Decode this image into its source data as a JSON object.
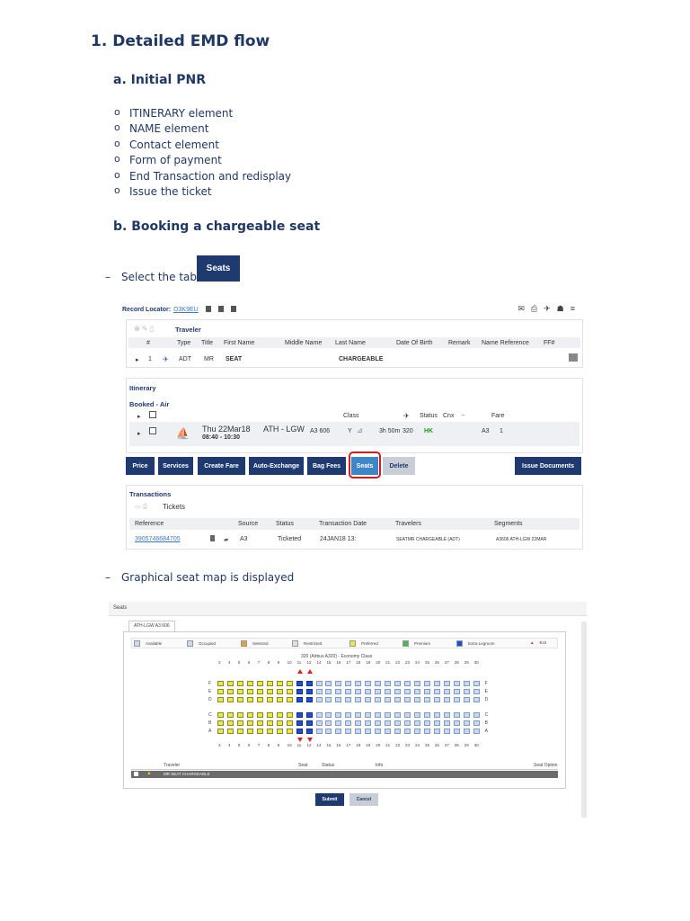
{
  "doc": {
    "h1": "1. Detailed EMD flow",
    "h2a": "a. Initial PNR",
    "bullets": [
      "ITINERARY element",
      "NAME element",
      "Contact element",
      "Form of payment",
      "End Transaction and redisplay",
      "Issue the ticket"
    ],
    "h2b": "b. Booking a chargeable seat",
    "step1": "Select the tab",
    "step1_badge": "Seats",
    "step2": "Graphical seat map is displayed",
    "dash": "–"
  },
  "pnr": {
    "record_locator_label": "Record Locator:",
    "record_locator": "O3K9EU",
    "traveler_title": "Traveler",
    "trav_cols": [
      "#",
      "Type",
      "Title",
      "First Name",
      "Middle Name",
      "Last Name",
      "Date Of Birth",
      "Remark",
      "Name Reference",
      "FF#"
    ],
    "trav_row": {
      "num": "1",
      "type": "ADT",
      "title": "MR",
      "first": "SEAT",
      "last": "CHARGEABLE"
    },
    "itinerary_title": "Itinerary",
    "booked_air": "Booked - Air",
    "itin_cols": {
      "class": "Class",
      "status": "Status",
      "cnx": "Cnx",
      "fare": "Fare"
    },
    "flight": {
      "date": "Thu 22Mar18",
      "time": "08:40 - 10:30",
      "route": "ATH - LGW",
      "flight": "A3 606",
      "class": "Y",
      "duration": "3h 50m",
      "equipment": "320",
      "status": "HK",
      "fare_carrier": "A3",
      "fare_num": "1"
    },
    "buttons": [
      "Price",
      "Services",
      "Create Fare",
      "Auto-Exchange",
      "Bag Fees",
      "Seats",
      "Delete"
    ],
    "issue_docs": "Issue Documents",
    "transactions_title": "Transactions",
    "tickets_label": "Tickets",
    "trx_cols": [
      "Reference",
      "Source",
      "Status",
      "Transaction Date",
      "Travelers",
      "Segments"
    ],
    "trx_row": {
      "ref": "3905746684705",
      "source": "A3",
      "status": "Ticketed",
      "date": "24JAN18 13:",
      "travelers": "SEATMR CHARGEABLE (ADT)",
      "segments": "A3606 ATH-LGW 22MAR"
    }
  },
  "seatmap": {
    "window_title": "Seats",
    "tab": "ATH-LGW A3 606",
    "legend": [
      "Available",
      "Occupied",
      "Selected",
      "Restricted",
      "Preferred",
      "Premium",
      "Extra Legroom",
      "Exit"
    ],
    "cabin": "320 (Airbus A320) - Economy Class",
    "rows_top": [
      "F",
      "E",
      "D"
    ],
    "rows_bottom": [
      "C",
      "B",
      "A"
    ],
    "col_numbers": [
      "3",
      "4",
      "5",
      "6",
      "7",
      "8",
      "9",
      "10",
      "11",
      "12",
      "14",
      "15",
      "16",
      "17",
      "18",
      "19",
      "20",
      "21",
      "22",
      "23",
      "24",
      "25",
      "26",
      "27",
      "28",
      "29",
      "30"
    ],
    "trav_cols": {
      "traveler": "Traveler",
      "seat": "Seat",
      "status": "Status",
      "info": "Info",
      "option": "Seat Option"
    },
    "trav_row": "MR SEAT CHARGEABLE",
    "submit": "Submit",
    "cancel": "Cancel"
  },
  "colors": {
    "navy": "#1f3864",
    "button": "#1f3a6e",
    "seats_button": "#3f86c8",
    "highlight": "#d41c1c",
    "hk": "#1aa21a",
    "available_seat": "#e8e84a",
    "extra_legroom": "#1a4fd6",
    "exit": "#e02020"
  }
}
